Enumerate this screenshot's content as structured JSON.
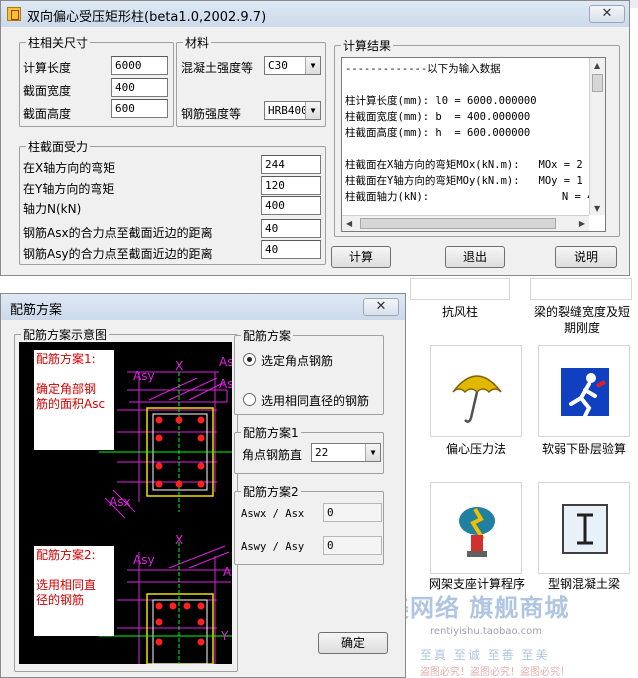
{
  "background": {
    "tiles": [
      {
        "label": "抗风柱"
      },
      {
        "label": "梁的裂缝宽度及短期刚度"
      },
      {
        "label": "偏心压力法",
        "icon": "umbrella-icon"
      },
      {
        "label": "软弱下卧层验算",
        "icon": "runner-icon"
      },
      {
        "label": "网架支座计算程序",
        "icon": "bolt-icon"
      },
      {
        "label": "型钢混凝土梁",
        "icon": "i-beam-icon"
      }
    ],
    "watermark": {
      "main": "酷美网络 旗舰商城",
      "url": "rentiyishu.taobao.com",
      "row": "至真 至诚  至善 至美",
      "warn": "盗图必究！盗图必究！盗图必究！"
    }
  },
  "main_window": {
    "title": "双向偏心受压矩形柱(beta1.0,2002.9.7)",
    "close_label": "✕",
    "column_group": {
      "legend": "柱相关尺寸",
      "fields": [
        {
          "label": "计算长度",
          "value": "6000"
        },
        {
          "label": "截面宽度",
          "value": "400"
        },
        {
          "label": "截面高度",
          "value": "600"
        }
      ]
    },
    "material_group": {
      "legend": "材料",
      "concrete_label": "混凝土强度等",
      "concrete_value": "C30",
      "steel_label": "钢筋强度等",
      "steel_value": "HRB400"
    },
    "load_group": {
      "legend": "柱截面受力",
      "fields": [
        {
          "label": "在X轴方向的弯矩",
          "value": "244"
        },
        {
          "label": "在Y轴方向的弯矩",
          "value": "120"
        },
        {
          "label": "轴力N(kN)",
          "value": "400"
        },
        {
          "label": "钢筋Asx的合力点至截面近边的距离",
          "value": "40"
        },
        {
          "label": "钢筋Asy的合力点至截面近边的距离",
          "value": "40"
        }
      ]
    },
    "results_group": {
      "legend": "计算结果",
      "lines": [
        "-------------以下为输入数据",
        "",
        "柱计算长度(mm): l0 = 6000.000000",
        "柱截面宽度(mm): b  = 400.000000",
        "柱截面高度(mm): h  = 600.000000",
        "",
        "柱截面在X轴方向的弯矩MOx(kN.m):   MOx = 2",
        "柱截面在Y轴方向的弯矩MOy(kN.m):   MOy = 1",
        "柱截面轴力(kN):                     N = 4"
      ]
    },
    "buttons": {
      "calc": "计算",
      "exit": "退出",
      "help": "说明"
    }
  },
  "dialog": {
    "title": "配筋方案",
    "close_label": "✕",
    "diagram_legend": "配筋方案示意图",
    "diagram": {
      "note1": "配筋方案1:\n\n确定角部钢\n筋的面积Asc",
      "note2": "配筋方案2:\n\n选用相同直\n径的钢筋",
      "labels": {
        "asy": "Asy",
        "x": "X",
        "aswy": "Aswy",
        "asc": "Asc",
        "asx": "Asx",
        "y": "Y",
        "aswx": "Aswx"
      },
      "colors": {
        "magenta": "#e020e0",
        "green": "#00ff00",
        "red": "#ff2020",
        "yellow": "#f0e000"
      }
    },
    "scheme_group": {
      "legend": "配筋方案",
      "options": [
        {
          "label": "选定角点钢筋",
          "checked": true
        },
        {
          "label": "选用相同直径的钢筋",
          "checked": false
        }
      ]
    },
    "scheme1": {
      "legend": "配筋方案1",
      "label": "角点钢筋直",
      "value": "22"
    },
    "scheme2": {
      "legend": "配筋方案2",
      "row1": "Aswx / Asx",
      "row2": "Aswy / Asy",
      "value1": "0",
      "value2": "0"
    },
    "ok_label": "确定"
  }
}
